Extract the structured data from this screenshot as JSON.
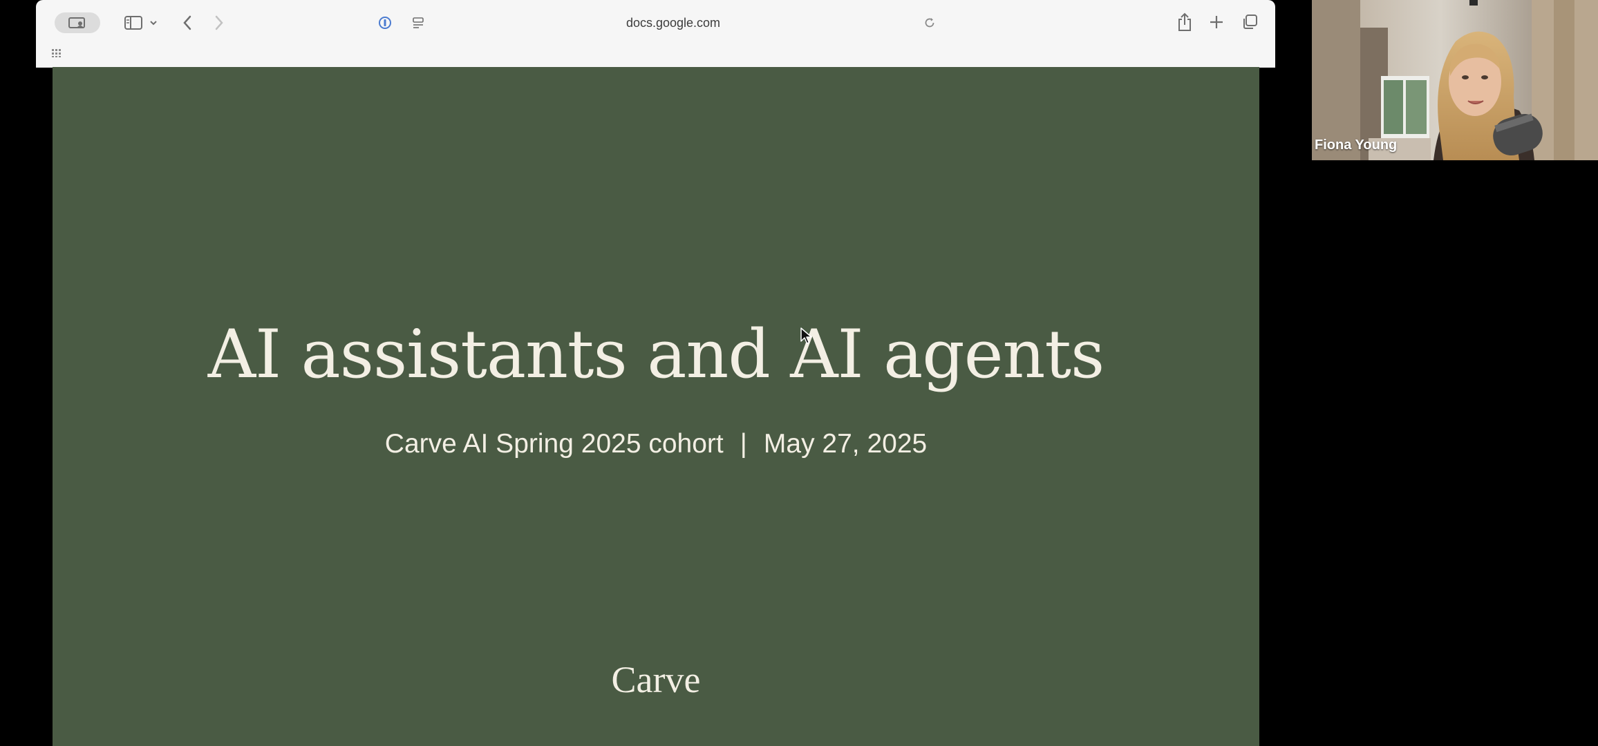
{
  "browser": {
    "url": "docs.google.com"
  },
  "slide": {
    "title": "AI assistants and AI agents",
    "subtitle_left": "Carve AI Spring 2025 cohort",
    "subtitle_separator": "|",
    "subtitle_right": "May 27, 2025",
    "logo": "Carve",
    "background": "#4a5b44",
    "text_color": "#f3efe4"
  },
  "video": {
    "participant_name": "Fiona Young"
  },
  "icons": {
    "profile": "profile-icon",
    "sidebar": "sidebar-icon",
    "chevron": "chevron-down-icon",
    "back": "back-arrow-icon",
    "forward": "forward-arrow-icon",
    "privacy": "privacy-report-icon",
    "page": "page-menu-icon",
    "reload": "reload-icon",
    "share": "share-icon",
    "new_tab": "plus-icon",
    "tabs": "tab-overview-icon",
    "grid": "grid-icon"
  }
}
